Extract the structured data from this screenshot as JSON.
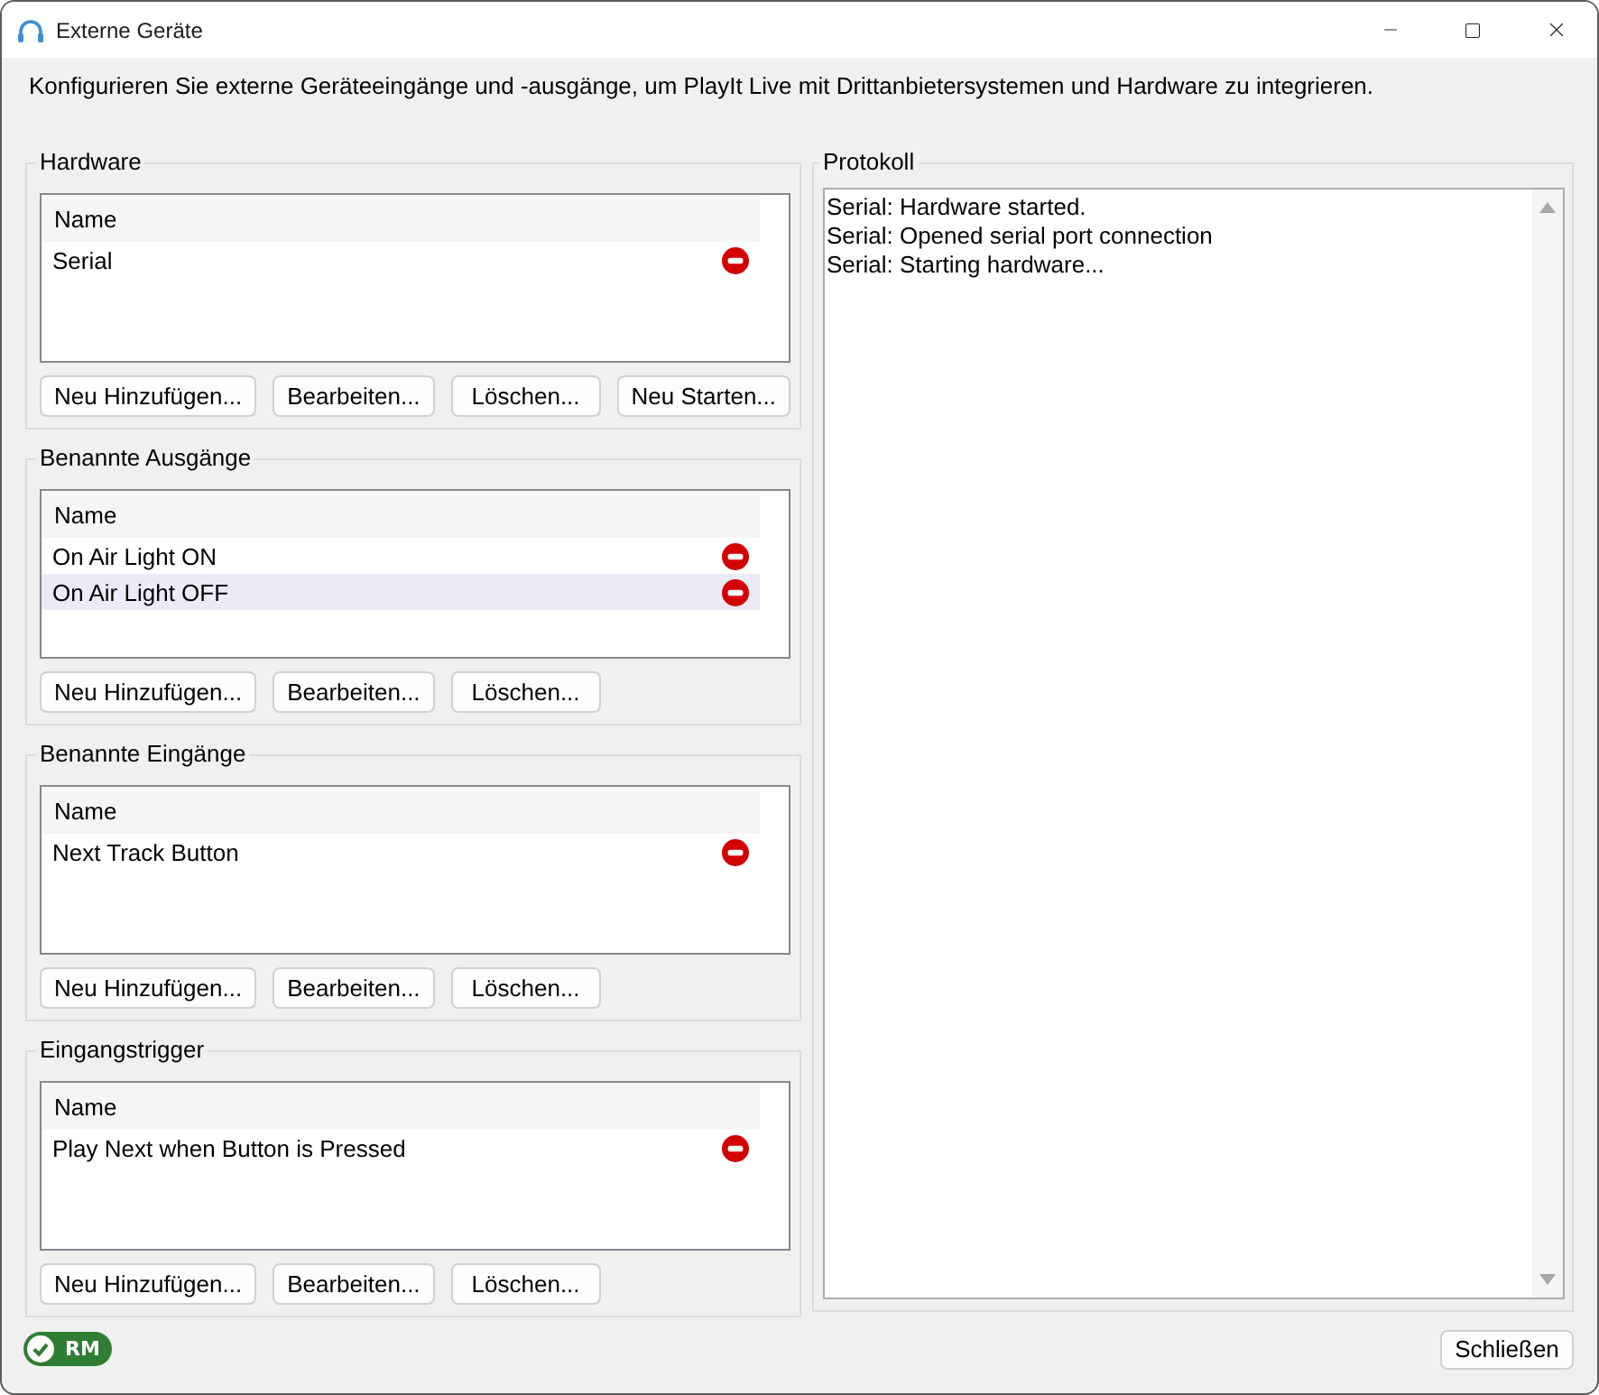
{
  "window": {
    "title": "Externe Geräte"
  },
  "description": "Konfigurieren Sie externe Geräteeingänge und -ausgänge, um PlayIt Live mit Drittanbietersystemen und Hardware zu integrieren.",
  "groups": [
    {
      "title": "Hardware",
      "column": "Name",
      "rows": [
        {
          "name": "Serial",
          "selected": false
        }
      ],
      "buttons": [
        "Neu Hinzufügen...",
        "Bearbeiten...",
        "Löschen...",
        "Neu Starten..."
      ]
    },
    {
      "title": "Benannte Ausgänge",
      "column": "Name",
      "rows": [
        {
          "name": "On Air Light ON",
          "selected": false
        },
        {
          "name": "On Air Light OFF",
          "selected": true
        }
      ],
      "buttons": [
        "Neu Hinzufügen...",
        "Bearbeiten...",
        "Löschen..."
      ]
    },
    {
      "title": "Benannte Eingänge",
      "column": "Name",
      "rows": [
        {
          "name": "Next Track Button",
          "selected": false
        }
      ],
      "buttons": [
        "Neu Hinzufügen...",
        "Bearbeiten...",
        "Löschen..."
      ]
    },
    {
      "title": "Eingangstrigger",
      "column": "Name",
      "rows": [
        {
          "name": "Play Next when Button is Pressed",
          "selected": false
        }
      ],
      "buttons": [
        "Neu Hinzufügen...",
        "Bearbeiten...",
        "Löschen..."
      ]
    }
  ],
  "log": {
    "title": "Protokoll",
    "lines": [
      "Serial: Hardware started.",
      "Serial: Opened serial port connection",
      "Serial: Starting hardware..."
    ]
  },
  "status_badge": {
    "label": "RM"
  },
  "close_button": "Schließen"
}
